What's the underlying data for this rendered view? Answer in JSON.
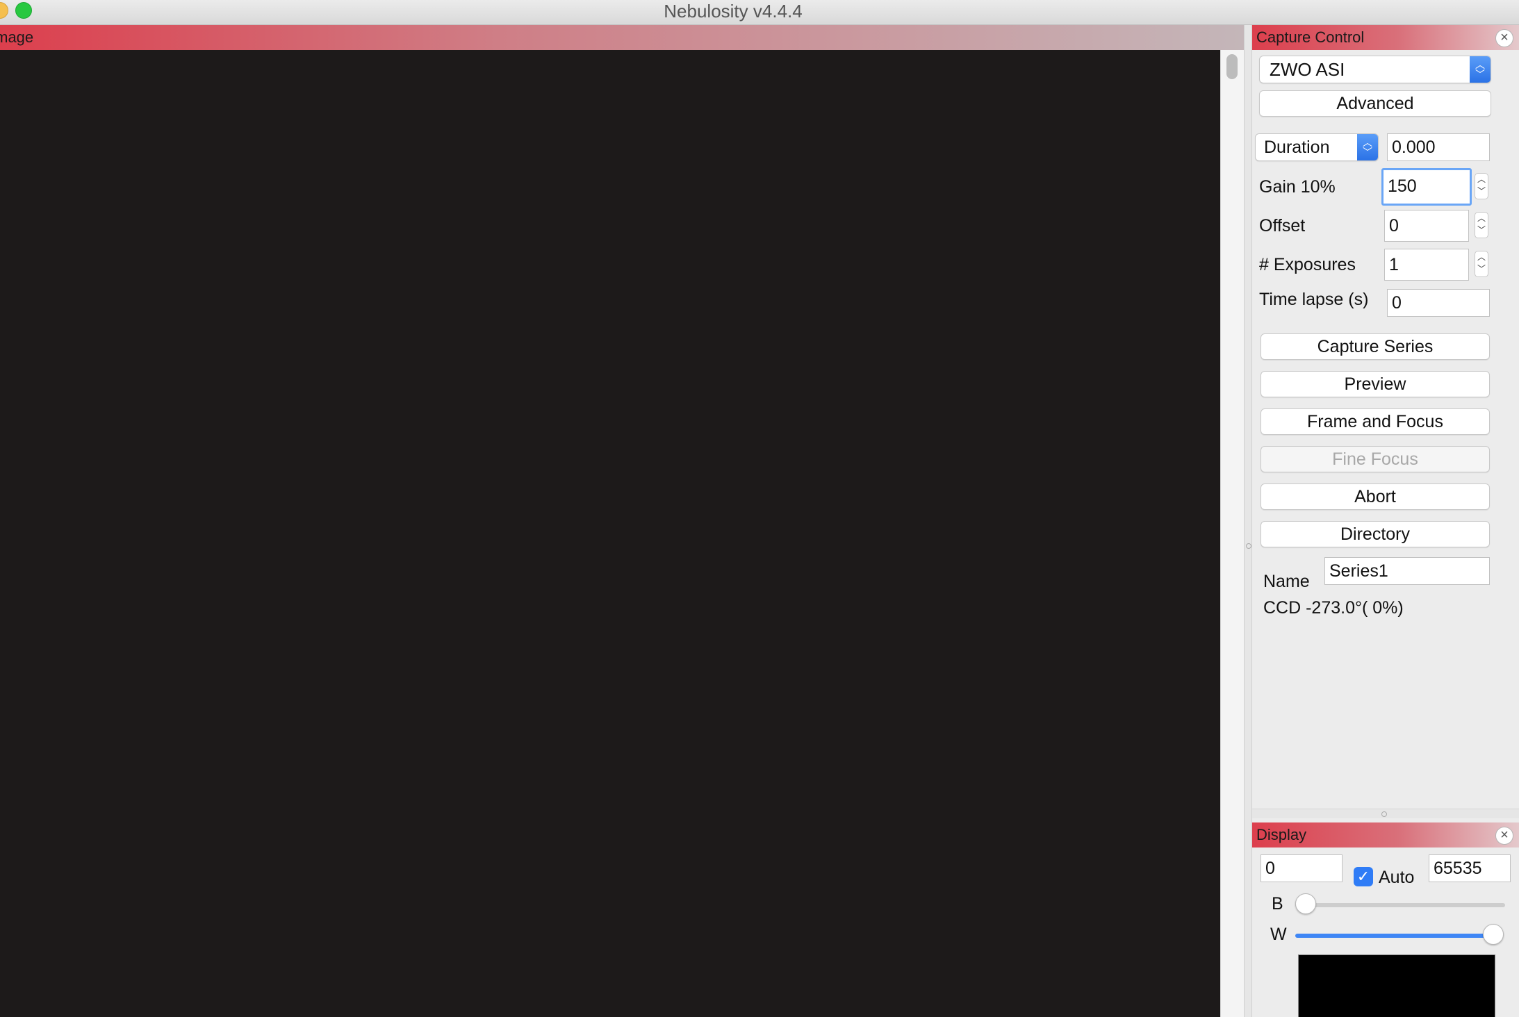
{
  "window": {
    "title": "Nebulosity v4.4.4"
  },
  "image_pane": {
    "title": "Image"
  },
  "capture_control": {
    "title": "Capture Control",
    "camera": "ZWO ASI",
    "advanced_label": "Advanced",
    "duration_mode": "Duration",
    "duration_value": "0.000",
    "gain_label": "Gain 10%",
    "gain_value": "150",
    "offset_label": "Offset",
    "offset_value": "0",
    "exposures_label": "# Exposures",
    "exposures_value": "1",
    "timelapse_label": "Time lapse (s)",
    "timelapse_value": "0",
    "buttons": {
      "capture_series": "Capture Series",
      "preview": "Preview",
      "frame_focus": "Frame and Focus",
      "fine_focus": "Fine Focus",
      "abort": "Abort",
      "directory": "Directory"
    },
    "name_label": "Name",
    "name_value": "Series1",
    "ccd_status": "CCD -273.0°( 0%)"
  },
  "display": {
    "title": "Display",
    "black_value": "0",
    "auto_label": "Auto",
    "auto_checked": true,
    "white_value": "65535",
    "b_label": "B",
    "w_label": "W",
    "b_slider_fraction": 0.0,
    "w_slider_fraction": 1.0
  },
  "colors": {
    "header_red": "#dc3f4d",
    "accent_blue": "#2f7cf6",
    "image_bg": "#1d1a1a"
  }
}
